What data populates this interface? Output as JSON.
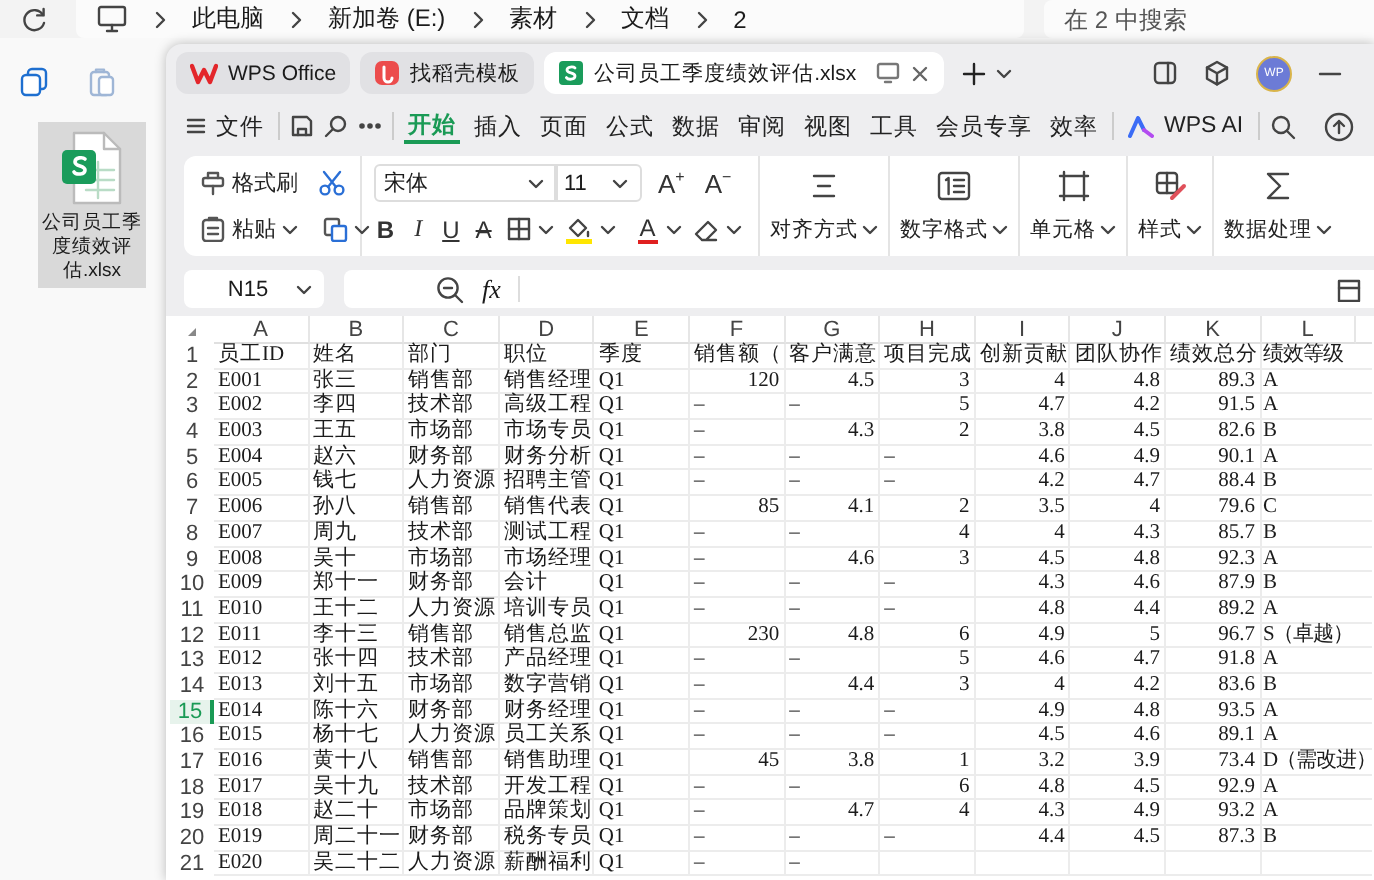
{
  "explorer": {
    "breadcrumb": [
      "此电脑",
      "新加卷 (E:)",
      "素材",
      "文档",
      "2"
    ],
    "search": {
      "placeholder": "在 2 中搜索"
    },
    "file": {
      "name": "公司员工季度绩效评估.xlsx",
      "selected": true
    }
  },
  "window": {
    "tabs": [
      {
        "label": "WPS Office",
        "kind": "home",
        "selected": false
      },
      {
        "label": "找稻壳模板",
        "kind": "template",
        "selected": false
      },
      {
        "label": "公司员工季度绩效评估.xlsx",
        "kind": "sheet",
        "selected": true
      }
    ],
    "avatar": "WP",
    "menu": {
      "file": "文件",
      "items": [
        {
          "label": "开始",
          "selected": true
        },
        {
          "label": "插入",
          "selected": false
        },
        {
          "label": "页面",
          "selected": false
        },
        {
          "label": "公式",
          "selected": false
        },
        {
          "label": "数据",
          "selected": false
        },
        {
          "label": "审阅",
          "selected": false
        },
        {
          "label": "视图",
          "selected": false
        },
        {
          "label": "工具",
          "selected": false
        },
        {
          "label": "会员专享",
          "selected": false
        },
        {
          "label": "效率",
          "selected": false
        }
      ],
      "ai": "WPS AI"
    },
    "ribbon": {
      "format_painter": "格式刷",
      "paste": "粘贴",
      "font": "宋体",
      "font_size": "11",
      "grow": "A$^{+}$",
      "shrink": "A$^{−}$",
      "style_buttons": [
        {
          "label": "B",
          "kind": "bold"
        },
        {
          "label": "I",
          "kind": "italic"
        },
        {
          "label": "U",
          "kind": "underline"
        },
        {
          "label": "A",
          "kind": "strike"
        }
      ],
      "font_color": "A",
      "groups": [
        {
          "label": "对齐方式",
          "kind": "align"
        },
        {
          "label": "数字格式",
          "kind": "number"
        },
        {
          "label": "单元格",
          "kind": "cell"
        },
        {
          "label": "样式",
          "kind": "style"
        },
        {
          "label": "数据处理",
          "kind": "data"
        }
      ]
    },
    "formula_bar": {
      "cell": "N15",
      "fx": "fx"
    },
    "sheet": {
      "columns": [
        "A",
        "B",
        "C",
        "D",
        "E",
        "F",
        "G",
        "H",
        "I",
        "J",
        "K",
        "L"
      ],
      "rows": [
        {
          "num": "1",
          "selected": false,
          "cells": [
            "员工ID",
            "姓名",
            "部门",
            "职位",
            "季度",
            "销售额（",
            "客户满意",
            "项目完成",
            "创新贡献",
            "团队协作",
            "绩效总分",
            "绩效等级"
          ]
        },
        {
          "num": "2",
          "selected": false,
          "cells": [
            "E001",
            "张三",
            "销售部",
            "销售经理",
            "Q1",
            {
              "num": "120"
            },
            {
              "num": "4.5"
            },
            {
              "num": "3"
            },
            {
              "num": "4"
            },
            {
              "num": "4.8"
            },
            {
              "num": "89.3"
            },
            "A"
          ]
        },
        {
          "num": "3",
          "selected": false,
          "cells": [
            "E002",
            "李四",
            "技术部",
            "高级工程",
            "Q1",
            "–",
            "–",
            {
              "num": "5"
            },
            {
              "num": "4.7"
            },
            {
              "num": "4.2"
            },
            {
              "num": "91.5"
            },
            "A"
          ]
        },
        {
          "num": "4",
          "selected": false,
          "cells": [
            "E003",
            "王五",
            "市场部",
            "市场专员",
            "Q1",
            "–",
            {
              "num": "4.3"
            },
            {
              "num": "2"
            },
            {
              "num": "3.8"
            },
            {
              "num": "4.5"
            },
            {
              "num": "82.6"
            },
            "B"
          ]
        },
        {
          "num": "5",
          "selected": false,
          "cells": [
            "E004",
            "赵六",
            "财务部",
            "财务分析",
            "Q1",
            "–",
            "–",
            "–",
            {
              "num": "4.6"
            },
            {
              "num": "4.9"
            },
            {
              "num": "90.1"
            },
            "A"
          ]
        },
        {
          "num": "6",
          "selected": false,
          "cells": [
            "E005",
            "钱七",
            "人力资源",
            "招聘主管",
            "Q1",
            "–",
            "–",
            "–",
            {
              "num": "4.2"
            },
            {
              "num": "4.7"
            },
            {
              "num": "88.4"
            },
            "B"
          ]
        },
        {
          "num": "7",
          "selected": false,
          "cells": [
            "E006",
            "孙八",
            "销售部",
            "销售代表",
            "Q1",
            {
              "num": "85"
            },
            {
              "num": "4.1"
            },
            {
              "num": "2"
            },
            {
              "num": "3.5"
            },
            {
              "num": "4"
            },
            {
              "num": "79.6"
            },
            "C"
          ]
        },
        {
          "num": "8",
          "selected": false,
          "cells": [
            "E007",
            "周九",
            "技术部",
            "测试工程",
            "Q1",
            "–",
            "–",
            {
              "num": "4"
            },
            {
              "num": "4"
            },
            {
              "num": "4.3"
            },
            {
              "num": "85.7"
            },
            "B"
          ]
        },
        {
          "num": "9",
          "selected": false,
          "cells": [
            "E008",
            "吴十",
            "市场部",
            "市场经理",
            "Q1",
            "–",
            {
              "num": "4.6"
            },
            {
              "num": "3"
            },
            {
              "num": "4.5"
            },
            {
              "num": "4.8"
            },
            {
              "num": "92.3"
            },
            "A"
          ]
        },
        {
          "num": "10",
          "selected": false,
          "cells": [
            "E009",
            "郑十一",
            "财务部",
            "会计",
            "Q1",
            "–",
            "–",
            "–",
            {
              "num": "4.3"
            },
            {
              "num": "4.6"
            },
            {
              "num": "87.9"
            },
            "B"
          ]
        },
        {
          "num": "11",
          "selected": false,
          "cells": [
            "E010",
            "王十二",
            "人力资源",
            "培训专员",
            "Q1",
            "–",
            "–",
            "–",
            {
              "num": "4.8"
            },
            {
              "num": "4.4"
            },
            {
              "num": "89.2"
            },
            "A"
          ]
        },
        {
          "num": "12",
          "selected": false,
          "cells": [
            "E011",
            "李十三",
            "销售部",
            "销售总监",
            "Q1",
            {
              "num": "230"
            },
            {
              "num": "4.8"
            },
            {
              "num": "6"
            },
            {
              "num": "4.9"
            },
            {
              "num": "5"
            },
            {
              "num": "96.7"
            },
            "S（卓越）"
          ]
        },
        {
          "num": "13",
          "selected": false,
          "cells": [
            "E012",
            "张十四",
            "技术部",
            "产品经理",
            "Q1",
            "–",
            "–",
            {
              "num": "5"
            },
            {
              "num": "4.6"
            },
            {
              "num": "4.7"
            },
            {
              "num": "91.8"
            },
            "A"
          ]
        },
        {
          "num": "14",
          "selected": false,
          "cells": [
            "E013",
            "刘十五",
            "市场部",
            "数字营销",
            "Q1",
            "–",
            {
              "num": "4.4"
            },
            {
              "num": "3"
            },
            {
              "num": "4"
            },
            {
              "num": "4.2"
            },
            {
              "num": "83.6"
            },
            "B"
          ]
        },
        {
          "num": "15",
          "selected": true,
          "cells": [
            "E014",
            "陈十六",
            "财务部",
            "财务经理",
            "Q1",
            "–",
            "–",
            "–",
            {
              "num": "4.9"
            },
            {
              "num": "4.8"
            },
            {
              "num": "93.5"
            },
            "A"
          ]
        },
        {
          "num": "16",
          "selected": false,
          "cells": [
            "E015",
            "杨十七",
            "人力资源",
            "员工关系",
            "Q1",
            "–",
            "–",
            "–",
            {
              "num": "4.5"
            },
            {
              "num": "4.6"
            },
            {
              "num": "89.1"
            },
            "A"
          ]
        },
        {
          "num": "17",
          "selected": false,
          "cells": [
            "E016",
            "黄十八",
            "销售部",
            "销售助理",
            "Q1",
            {
              "num": "45"
            },
            {
              "num": "3.8"
            },
            {
              "num": "1"
            },
            {
              "num": "3.2"
            },
            {
              "num": "3.9"
            },
            {
              "num": "73.4"
            },
            "D（需改进）"
          ]
        },
        {
          "num": "18",
          "selected": false,
          "cells": [
            "E017",
            "吴十九",
            "技术部",
            "开发工程",
            "Q1",
            "–",
            "–",
            {
              "num": "6"
            },
            {
              "num": "4.8"
            },
            {
              "num": "4.5"
            },
            {
              "num": "92.9"
            },
            "A"
          ]
        },
        {
          "num": "19",
          "selected": false,
          "cells": [
            "E018",
            "赵二十",
            "市场部",
            "品牌策划",
            "Q1",
            "–",
            {
              "num": "4.7"
            },
            {
              "num": "4"
            },
            {
              "num": "4.3"
            },
            {
              "num": "4.9"
            },
            {
              "num": "93.2"
            },
            "A"
          ]
        },
        {
          "num": "20",
          "selected": false,
          "cells": [
            "E019",
            "周二十一",
            "财务部",
            "税务专员",
            "Q1",
            "–",
            "–",
            "–",
            {
              "num": "4.4"
            },
            {
              "num": "4.5"
            },
            {
              "num": "87.3"
            },
            "B"
          ]
        },
        {
          "num": "21",
          "selected": false,
          "cells": [
            "E020",
            "吴二十二",
            "人力资源",
            "薪酬福利",
            "Q1",
            "–",
            "–",
            "",
            "",
            "",
            "",
            ""
          ]
        }
      ]
    }
  }
}
